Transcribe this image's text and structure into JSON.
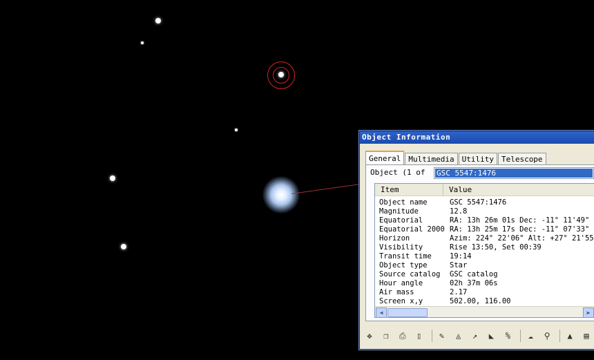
{
  "window": {
    "title": "Object Information",
    "tabs": [
      {
        "label": "General",
        "active": true
      },
      {
        "label": "Multimedia",
        "active": false
      },
      {
        "label": "Utility",
        "active": false
      },
      {
        "label": "Telescope",
        "active": false
      }
    ],
    "object_label": "Object (1 of",
    "object_value": "GSC 5547:1476",
    "columns": [
      "Item",
      "Value"
    ],
    "rows": [
      {
        "item": "Object name",
        "value": "GSC 5547:1476"
      },
      {
        "item": "Magnitude",
        "value": "12.8"
      },
      {
        "item": "Equatorial",
        "value": "RA: 13h 26m 01s   Dec: -11° 11'49\""
      },
      {
        "item": "Equatorial 2000",
        "value": "RA: 13h 25m 17s   Dec: -11° 07'33\""
      },
      {
        "item": "Horizon",
        "value": "Azim: 224° 22'06\"   Alt: +27° 21'55\""
      },
      {
        "item": "Visibility",
        "value": "Rise 13:50,  Set 00:39"
      },
      {
        "item": "Transit time",
        "value": "19:14"
      },
      {
        "item": "Object type",
        "value": "Star"
      },
      {
        "item": "Source catalog",
        "value": "GSC catalog"
      },
      {
        "item": "Hour angle",
        "value": "02h 37m 06s"
      },
      {
        "item": "Air mass",
        "value": "2.17"
      },
      {
        "item": "Screen x,y",
        "value": "502.00, 116.00"
      }
    ],
    "toolbar_icons": [
      "center-icon",
      "copy-icon",
      "print-icon",
      "book-icon",
      "pencil-icon",
      "chart-icon",
      "arrow-icon",
      "graph-icon",
      "percent-icon",
      "cloud-icon",
      "find-icon",
      "up-icon",
      "folder-icon"
    ]
  }
}
